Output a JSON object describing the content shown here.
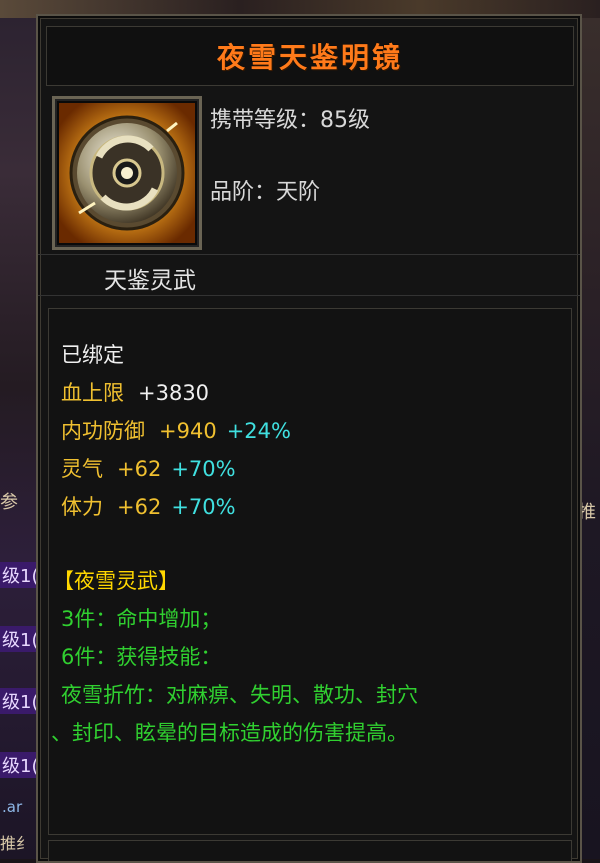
{
  "item": {
    "title": "夜雪天鉴明镜",
    "level_label": "携带等级：",
    "level_value": "85级",
    "grade_label": "品阶：",
    "grade_value": "天阶",
    "subtitle": "天鉴灵武"
  },
  "stats": {
    "bound": "已绑定",
    "lines": [
      {
        "name": "血上限",
        "value": "+3830",
        "pct": ""
      },
      {
        "name": "内功防御",
        "value": "+940",
        "pct": "+24%"
      },
      {
        "name": "灵气",
        "value": "+62",
        "pct": "+70%"
      },
      {
        "name": "体力",
        "value": "+62",
        "pct": "+70%"
      }
    ]
  },
  "set": {
    "name": "【夜雪灵武】",
    "bonus3": "3件：命中增加；",
    "bonus6": "6件：获得技能：",
    "skill_line1": "夜雪折竹：对麻痹、失明、散功、封穴",
    "skill_line2": "、封印、眩晕的目标造成的伤害提高。"
  },
  "background": {
    "left_frag_1": "参",
    "right_frag_1": "推",
    "lvl_frags": [
      "级1(",
      "级1(",
      "级1(",
      "级1(",
      "级1("
    ],
    "link_frag": ".ar",
    "bottom_left_frag": "推纟"
  },
  "colors": {
    "title": "#ff7a1a",
    "stat_name": "#f0c030",
    "percent": "#40e0e0",
    "set_text": "#30d030",
    "set_name": "#ffd700"
  }
}
